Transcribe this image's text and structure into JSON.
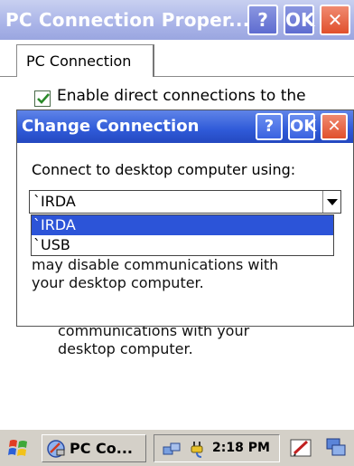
{
  "window": {
    "title": "PC Connection Proper...",
    "help_label": "?",
    "ok_label": "OK",
    "close_label": "✕"
  },
  "tab": {
    "label": "PC Connection"
  },
  "enable_checkbox": {
    "label": "Enable direct connections to the",
    "checked": true
  },
  "dialog": {
    "title": "Change Connection",
    "help_label": "?",
    "ok_label": "OK",
    "close_label": "✕",
    "connect_label": "Connect to desktop computer using:",
    "selected_value": "`IRDA",
    "options": [
      "`IRDA",
      "`USB"
    ],
    "body_line1": "may disable communications with",
    "body_line2": "your desktop computer."
  },
  "behind": {
    "line1": "communications with your",
    "line2": "desktop computer."
  },
  "taskbar": {
    "task_label": "PC Co...",
    "clock": "2:18 PM"
  },
  "colors": {
    "dialog_title": "#2f5ad8",
    "selection": "#2c54d8",
    "close_red": "#e0502c"
  }
}
